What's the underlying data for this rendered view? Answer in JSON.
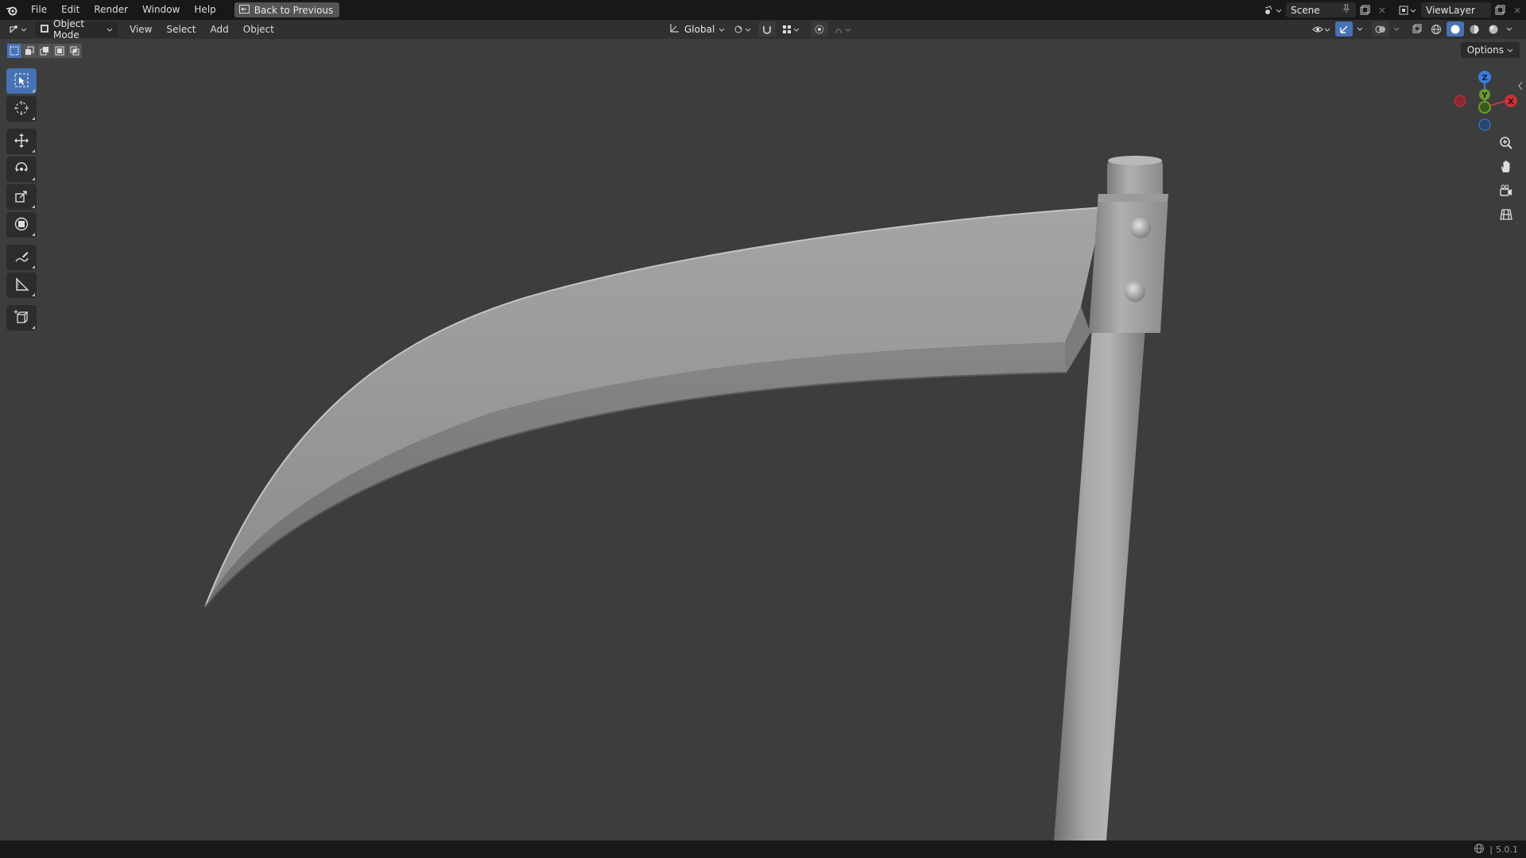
{
  "topbar": {
    "menu": [
      "File",
      "Edit",
      "Render",
      "Window",
      "Help"
    ],
    "back_button": "Back to Previous",
    "scene": "Scene",
    "view_layer": "ViewLayer"
  },
  "header": {
    "mode": "Object Mode",
    "menus": [
      "View",
      "Select",
      "Add",
      "Object"
    ],
    "transform_orientation": "Global",
    "options": "Options"
  },
  "toolbar": {
    "tools": [
      "select-box",
      "cursor",
      "move",
      "rotate",
      "scale",
      "transform",
      "annotate",
      "measure",
      "add-cube"
    ]
  },
  "navigation": {
    "gizmo_axes": [
      "Z",
      "Y",
      "X"
    ],
    "controls": [
      "zoom",
      "pan",
      "camera",
      "perspective-ortho"
    ]
  },
  "status": {
    "version": "5.0.1"
  },
  "colors": {
    "viewport_bg": "#3d3d3d",
    "accent": "#4772b3",
    "axis_x": "#c8323c",
    "axis_y": "#6a9a2e",
    "axis_z": "#3b7dd8"
  }
}
